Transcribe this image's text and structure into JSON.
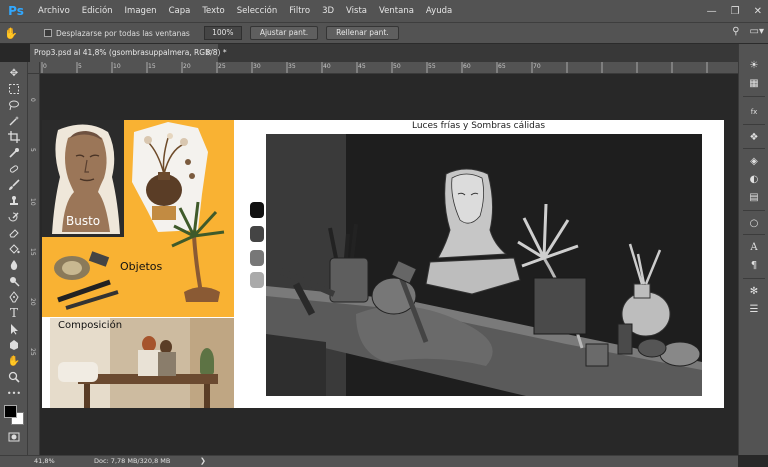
{
  "app": {
    "logo": "Ps"
  },
  "menu": [
    "Archivo",
    "Edición",
    "Imagen",
    "Capa",
    "Texto",
    "Selección",
    "Filtro",
    "3D",
    "Vista",
    "Ventana",
    "Ayuda"
  ],
  "options": {
    "scroll_all_label": "Desplazarse por todas las ventanas",
    "zoom_value": "100%",
    "fit_screen": "Ajustar pant.",
    "fill_screen": "Rellenar pant."
  },
  "document_tab": {
    "title": "Prop3.psd al 41,8% (gsombrasuppalmera, RGB/8) *"
  },
  "rulers": {
    "h_ticks": [
      "0",
      "5",
      "10",
      "15",
      "20",
      "25",
      "30",
      "35",
      "40",
      "45",
      "50",
      "55",
      "60",
      "65",
      "70"
    ],
    "v_ticks": [
      "0",
      "5",
      "10",
      "15",
      "20",
      "25"
    ]
  },
  "artwork": {
    "labels": {
      "busto": "Busto",
      "objetos": "Objetos",
      "composicion": "Composición"
    },
    "scene_title": "Luces frías y Sombras cálidas",
    "swatches": [
      "#111111",
      "#444444",
      "#777777",
      "#aaaaaa"
    ]
  },
  "status": {
    "zoom": "41,8%",
    "doc": "Doc: 7,78 MB/320,8 MB"
  },
  "colors": {
    "accent_orange": "#f9b233",
    "ps_blue": "#31a8ff"
  }
}
